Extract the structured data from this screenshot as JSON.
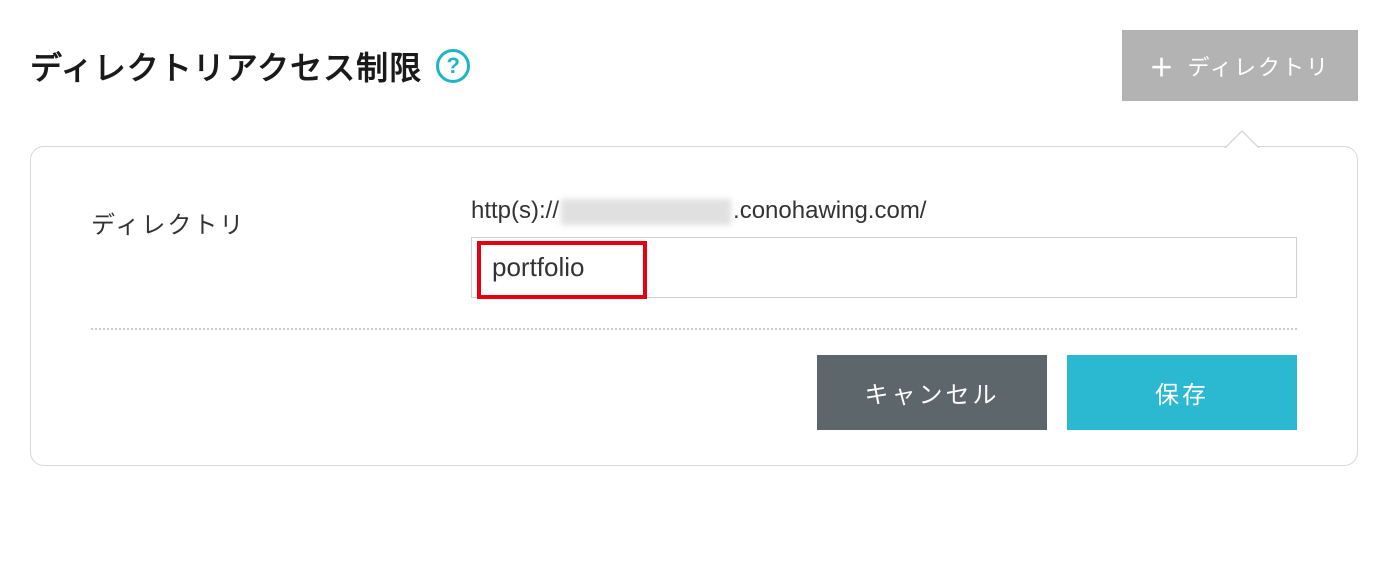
{
  "header": {
    "title": "ディレクトリアクセス制限",
    "help_glyph": "?",
    "add_button_label": "ディレクトリ",
    "plus_glyph": "＋"
  },
  "form": {
    "directory_label": "ディレクトリ",
    "url_prefix_before": "http(s)://",
    "url_prefix_after": ".conohawing.com/",
    "directory_value": "portfolio"
  },
  "actions": {
    "cancel_label": "キャンセル",
    "save_label": "保存"
  }
}
